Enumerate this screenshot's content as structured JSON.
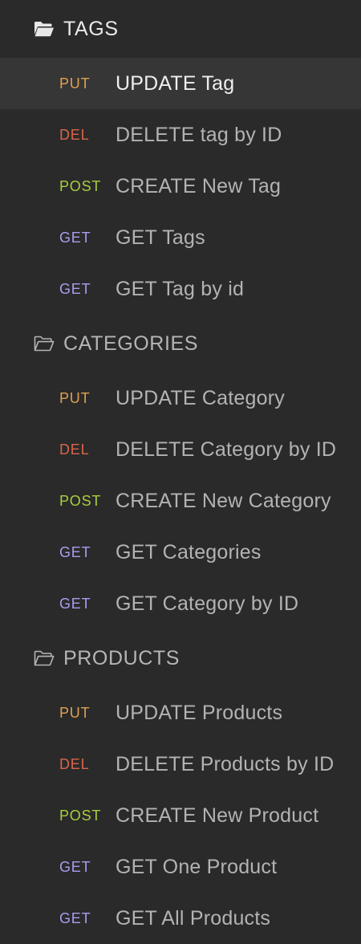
{
  "colors": {
    "background": "#2a2a2a",
    "active_row": "#363636",
    "method_put": "#e0a050",
    "method_del": "#d9664a",
    "method_post": "#a8cf3e",
    "method_get": "#a99cf0"
  },
  "folders": [
    {
      "label": "TAGS",
      "icon": "folder-open-filled-icon",
      "requests": [
        {
          "method": "PUT",
          "label": "UPDATE Tag",
          "active": true
        },
        {
          "method": "DEL",
          "label": "DELETE tag by ID"
        },
        {
          "method": "POST",
          "label": "CREATE New Tag"
        },
        {
          "method": "GET",
          "label": "GET Tags"
        },
        {
          "method": "GET",
          "label": "GET Tag by id"
        }
      ]
    },
    {
      "label": "CATEGORIES",
      "icon": "folder-open-outline-icon",
      "requests": [
        {
          "method": "PUT",
          "label": "UPDATE Category"
        },
        {
          "method": "DEL",
          "label": "DELETE Category by ID"
        },
        {
          "method": "POST",
          "label": "CREATE New Category"
        },
        {
          "method": "GET",
          "label": "GET Categories"
        },
        {
          "method": "GET",
          "label": "GET Category by ID"
        }
      ]
    },
    {
      "label": "PRODUCTS",
      "icon": "folder-open-outline-icon",
      "requests": [
        {
          "method": "PUT",
          "label": "UPDATE Products"
        },
        {
          "method": "DEL",
          "label": "DELETE Products by ID"
        },
        {
          "method": "POST",
          "label": "CREATE New Product"
        },
        {
          "method": "GET",
          "label": "GET One Product"
        },
        {
          "method": "GET",
          "label": "GET All Products"
        }
      ]
    }
  ]
}
